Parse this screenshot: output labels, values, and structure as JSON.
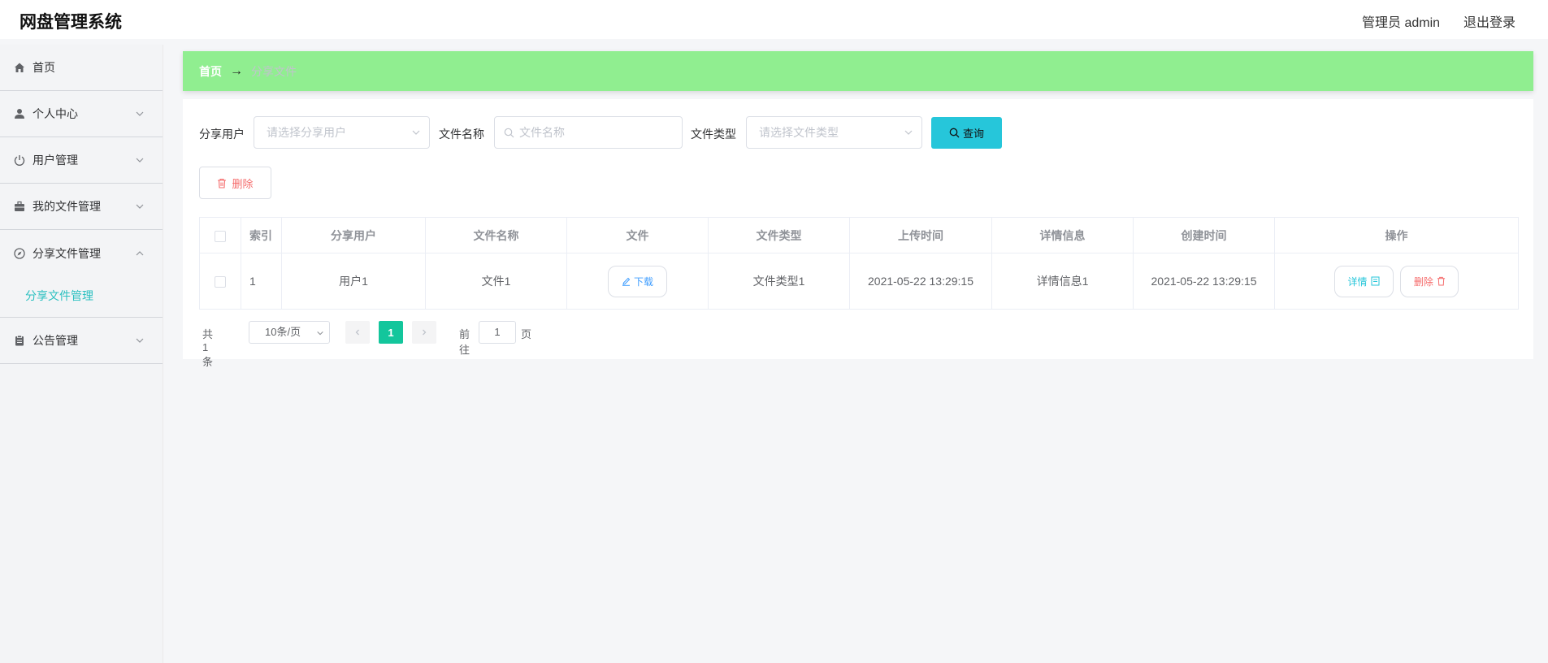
{
  "app": {
    "title": "网盘管理系统",
    "user_label": "管理员 admin",
    "logout_label": "退出登录"
  },
  "sidebar": {
    "items": [
      {
        "label": "首页",
        "icon": "home-icon"
      },
      {
        "label": "个人中心",
        "icon": "user-icon"
      },
      {
        "label": "用户管理",
        "icon": "power-icon"
      },
      {
        "label": "我的文件管理",
        "icon": "briefcase-icon"
      },
      {
        "label": "分享文件管理",
        "icon": "compass-icon",
        "expanded": true,
        "children": [
          {
            "label": "分享文件管理",
            "active": true
          }
        ]
      },
      {
        "label": "公告管理",
        "icon": "clipboard-icon"
      }
    ]
  },
  "breadcrumb": {
    "home": "首页",
    "separator": "→",
    "current": "分享文件"
  },
  "filters": {
    "share_user_label": "分享用户",
    "share_user_placeholder": "请选择分享用户",
    "file_name_label": "文件名称",
    "file_name_placeholder": "文件名称",
    "file_type_label": "文件类型",
    "file_type_placeholder": "请选择文件类型",
    "query_button": "查询"
  },
  "actions": {
    "delete_button": "删除"
  },
  "table": {
    "columns": [
      "",
      "索引",
      "分享用户",
      "文件名称",
      "文件",
      "文件类型",
      "上传时间",
      "详情信息",
      "创建时间",
      "操作"
    ],
    "rows": [
      {
        "index": "1",
        "share_user": "用户1",
        "file_name": "文件1",
        "file_button": "下载",
        "file_type": "文件类型1",
        "upload_time": "2021-05-22 13:29:15",
        "details": "详情信息1",
        "created_time": "2021-05-22 13:29:15",
        "detail_button": "详情",
        "delete_button": "删除"
      }
    ]
  },
  "pagination": {
    "total": "共 1 条",
    "page_size": "10条/页",
    "current_page": "1",
    "goto_label": "前往",
    "goto_value": "1",
    "page_suffix": "页"
  },
  "colors": {
    "breadcrumb_bg": "#90ee90",
    "query_button": "#26c6da",
    "active_page": "#13c69c",
    "danger": "#f56c6c",
    "submenu_active": "#2bc0c0"
  }
}
